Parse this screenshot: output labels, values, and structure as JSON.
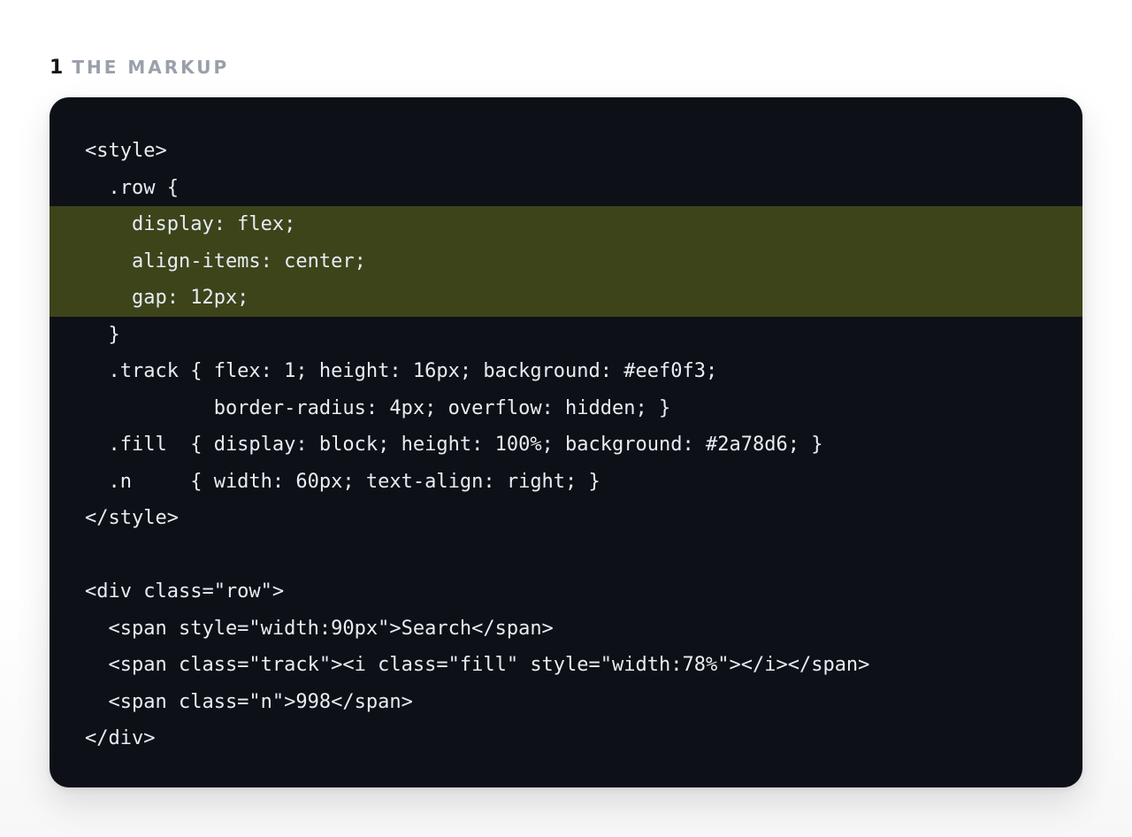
{
  "section": {
    "number": "1",
    "title": "THE MARKUP"
  },
  "code": {
    "lines": [
      {
        "text": "<style>",
        "highlight": false
      },
      {
        "text": "  .row {",
        "highlight": false
      },
      {
        "text": "    display: flex;",
        "highlight": true
      },
      {
        "text": "    align-items: center;",
        "highlight": true
      },
      {
        "text": "    gap: 12px;",
        "highlight": true
      },
      {
        "text": "  }",
        "highlight": false
      },
      {
        "text": "  .track { flex: 1; height: 16px; background: #eef0f3;",
        "highlight": false
      },
      {
        "text": "           border-radius: 4px; overflow: hidden; }",
        "highlight": false
      },
      {
        "text": "  .fill  { display: block; height: 100%; background: #2a78d6; }",
        "highlight": false
      },
      {
        "text": "  .n     { width: 60px; text-align: right; }",
        "highlight": false
      },
      {
        "text": "</style>",
        "highlight": false
      },
      {
        "text": "",
        "highlight": false
      },
      {
        "text": "<div class=\"row\">",
        "highlight": false
      },
      {
        "text": "  <span style=\"width:90px\">Search</span>",
        "highlight": false
      },
      {
        "text": "  <span class=\"track\"><i class=\"fill\" style=\"width:78%\"></i></span>",
        "highlight": false
      },
      {
        "text": "  <span class=\"n\">998</span>",
        "highlight": false
      },
      {
        "text": "</div>",
        "highlight": false
      }
    ]
  }
}
